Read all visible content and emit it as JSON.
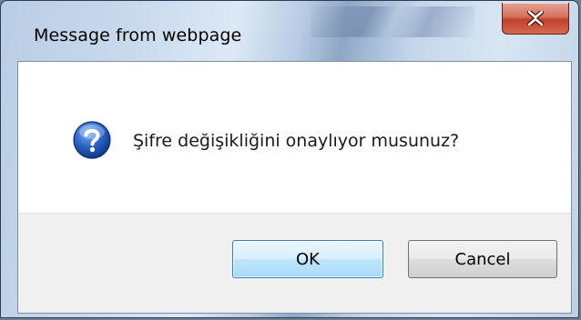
{
  "window": {
    "title": "Message from webpage",
    "close_icon": "close-icon"
  },
  "message": {
    "icon": "question-icon",
    "text": "Şifre değişikliğini onaylıyor musunuz?"
  },
  "buttons": {
    "ok_label": "OK",
    "cancel_label": "Cancel"
  },
  "colors": {
    "close_button": "#c7513b",
    "question_icon": "#1f57b8",
    "button_panel": "#f0f0f0"
  }
}
